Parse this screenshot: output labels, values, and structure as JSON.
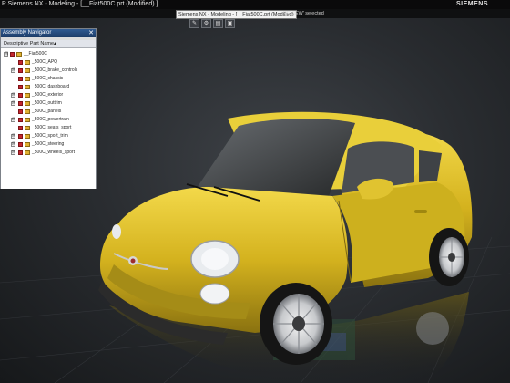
{
  "window": {
    "title": "P Siemens NX - Modeling - [__Fiat500C.prt (Modified) ]",
    "brand": "SIEMENS"
  },
  "strip": {
    "tooltip": "Siemens NX - Modeling - [__Fiat500C.prt (Modified)",
    "status": "REVIEW' selected"
  },
  "toolbar": {
    "buttons": [
      {
        "icon": "pencil-icon",
        "glyph": "✎"
      },
      {
        "icon": "gear-icon",
        "glyph": "⚙"
      },
      {
        "icon": "layout-icon",
        "glyph": "▤"
      },
      {
        "icon": "window-icon",
        "glyph": "▣"
      }
    ]
  },
  "navigator": {
    "title": "Assembly Navigator",
    "close_glyph": "✕",
    "column_header": "Descriptive Part Name",
    "sort_glyph": "▲",
    "items": [
      {
        "label": "__Fiat500C",
        "expander": "⊟"
      },
      {
        "label": "_500C_APQ",
        "expander": ""
      },
      {
        "label": "_500C_brake_controls",
        "expander": "⊞"
      },
      {
        "label": "_500C_chassis",
        "expander": ""
      },
      {
        "label": "_500C_dashboard",
        "expander": ""
      },
      {
        "label": "_500C_exterior",
        "expander": "⊞"
      },
      {
        "label": "_500C_outtrim",
        "expander": "⊞"
      },
      {
        "label": "_500C_panels",
        "expander": ""
      },
      {
        "label": "_500C_powertrain",
        "expander": "⊞"
      },
      {
        "label": "_500C_seats_sport",
        "expander": ""
      },
      {
        "label": "_500C_sport_trim",
        "expander": "⊞"
      },
      {
        "label": "_500C_steering",
        "expander": "⊞"
      },
      {
        "label": "_500C_wheels_sport",
        "expander": "⊞"
      }
    ]
  },
  "colors": {
    "car_body": "#d9b820",
    "viewport_bg": "#2a2d31"
  }
}
